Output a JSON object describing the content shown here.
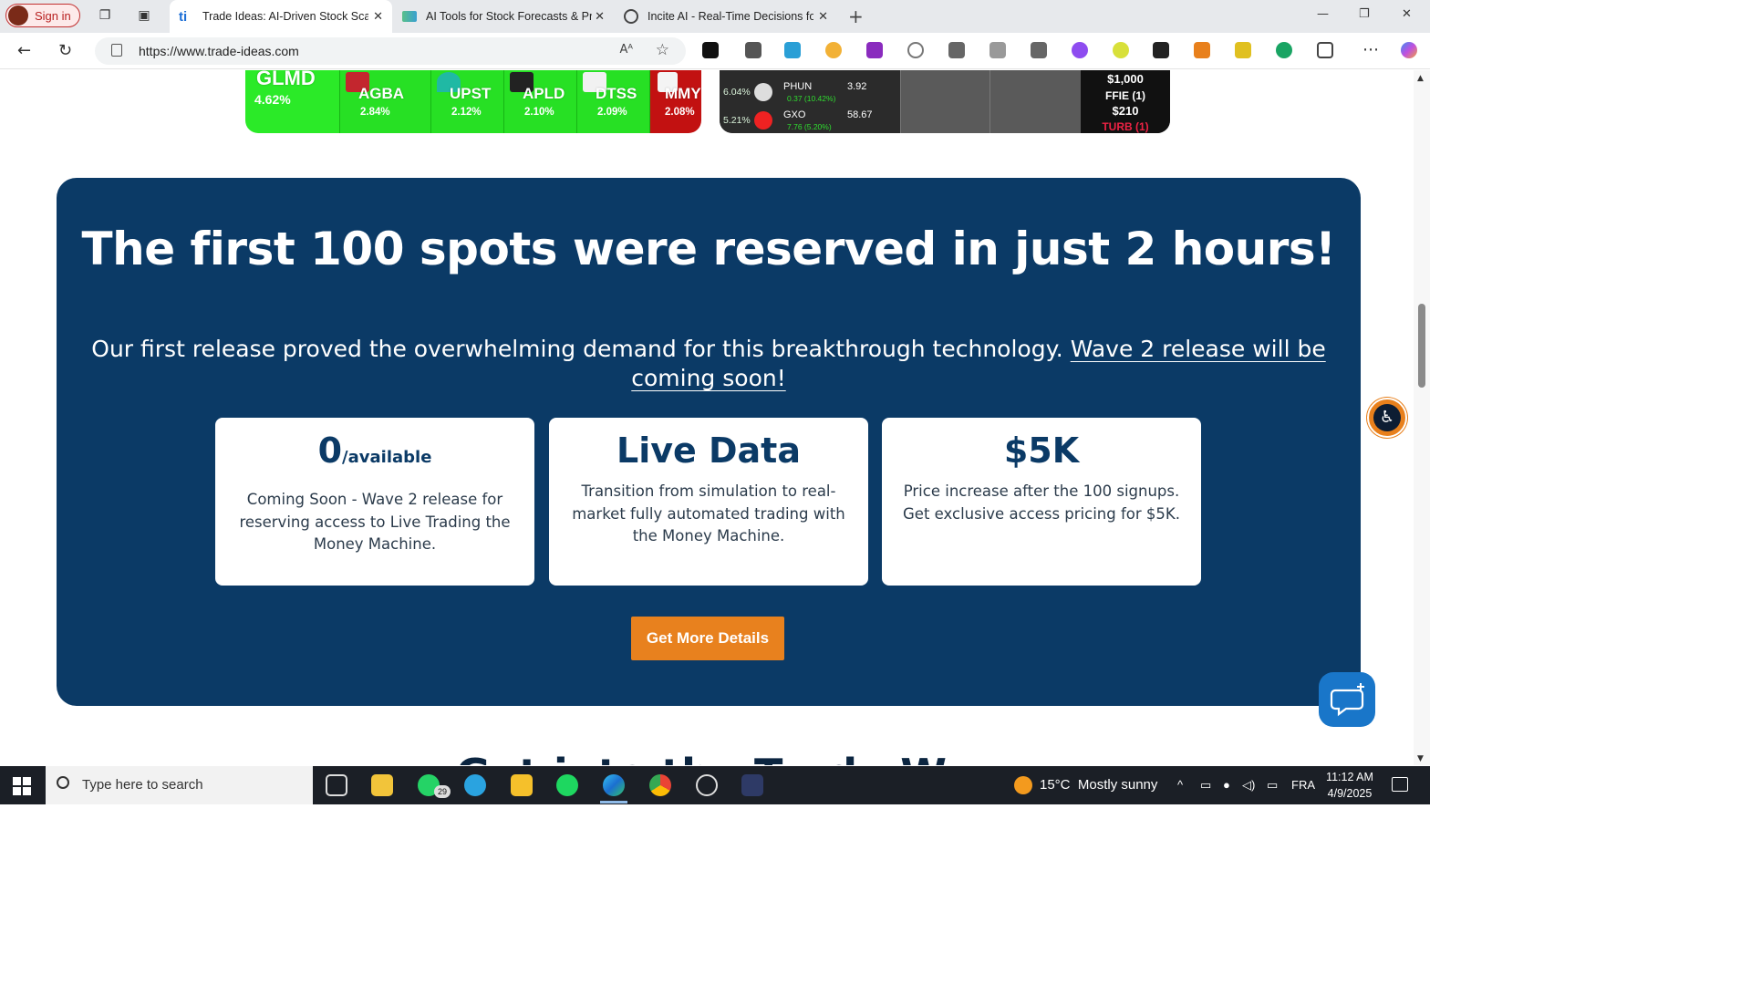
{
  "browser": {
    "signin_label": "Sign in",
    "tabs": [
      {
        "title": "Trade Ideas: AI-Driven Stock Scan",
        "active": true
      },
      {
        "title": "AI Tools for Stock Forecasts & Pric",
        "active": false
      },
      {
        "title": "Incite AI - Real-Time Decisions fo",
        "active": false
      }
    ],
    "url": "https://www.trade-ideas.com",
    "read_aloud": "Aᴬ",
    "newtab_icon": "+"
  },
  "heatmap": {
    "cells": [
      {
        "symbol": "GLMD",
        "change": "4.62%"
      },
      {
        "symbol": "AGBA",
        "change": "2.84%"
      },
      {
        "symbol": "UPST",
        "change": "2.12%"
      },
      {
        "symbol": "APLD",
        "change": "2.10%"
      },
      {
        "symbol": "DTSS",
        "change": "2.09%"
      },
      {
        "symbol": "MMY",
        "change": "2.08%"
      }
    ]
  },
  "screener": {
    "rows": [
      {
        "pct": "6.04%",
        "ticker": "PHUN",
        "price": "3.92",
        "change": "0.37 (10.42%)"
      },
      {
        "pct": "5.21%",
        "ticker": "GXO",
        "price": "58.67",
        "change": "7.76 (5.20%)"
      }
    ],
    "panel": {
      "amount1": "$1,000",
      "item": "FFIE (1)",
      "amount2": "$210",
      "item2": "TURB (1)"
    }
  },
  "promo": {
    "headline": "The first 100 spots were reserved in just 2 hours!",
    "sub_part1": "Our first release proved the overwhelming demand for this breakthrough technology.",
    "sub_link": "Wave 2 release will be coming soon!",
    "cards": [
      {
        "value": "0",
        "value_suffix": "/available",
        "desc": "Coming Soon - Wave 2 release for reserving access to Live Trading the Money Machine."
      },
      {
        "value": "Live Data",
        "value_suffix": "",
        "desc": "Transition from simulation to real-market fully automated trading with the Money Machine."
      },
      {
        "value": "$5K",
        "value_suffix": "",
        "desc": "Price increase after the 100 signups. Get exclusive access pricing for $5K."
      }
    ],
    "cta_label": "Get More Details"
  },
  "next_section_heading": "Get into the Trade W",
  "taskbar": {
    "search_placeholder": "Type here to search",
    "whatsapp_badge": "29",
    "weather_temp": "15°C",
    "weather_desc": "Mostly sunny",
    "lang": "FRA",
    "time": "11:12 AM",
    "date": "4/9/2025"
  },
  "colors": {
    "panel_bg": "#0b3a66",
    "cta_bg": "#e8811e",
    "heat_green": "#27e024",
    "heat_red": "#c21111"
  }
}
